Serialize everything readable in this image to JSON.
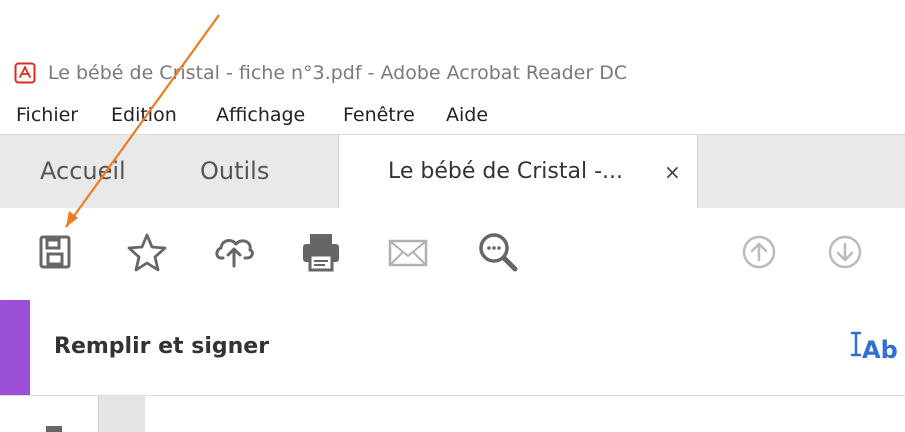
{
  "window": {
    "title": "Le bébé de Cristal - fiche n°3.pdf - Adobe Acrobat Reader DC",
    "app_icon": "acrobat-icon"
  },
  "menu": {
    "items": [
      {
        "label": "Fichier"
      },
      {
        "label": "Edition"
      },
      {
        "label": "Affichage"
      },
      {
        "label": "Fenêtre"
      },
      {
        "label": "Aide"
      }
    ]
  },
  "tabs": {
    "home": "Accueil",
    "tools": "Outils",
    "document": "Le bébé de Cristal -...",
    "close": "×"
  },
  "toolbar": {
    "icons": [
      "save-icon",
      "star-icon",
      "cloud-upload-icon",
      "print-icon",
      "email-icon",
      "zoom-search-icon",
      "page-up-icon",
      "page-down-icon"
    ]
  },
  "fill_sign": {
    "title": "Remplir et signer",
    "text_button": "Ab"
  },
  "colors": {
    "accent_purple": "#9a4fd6",
    "link_blue": "#2d72d2",
    "annotation_arrow": "#f07a1f"
  }
}
